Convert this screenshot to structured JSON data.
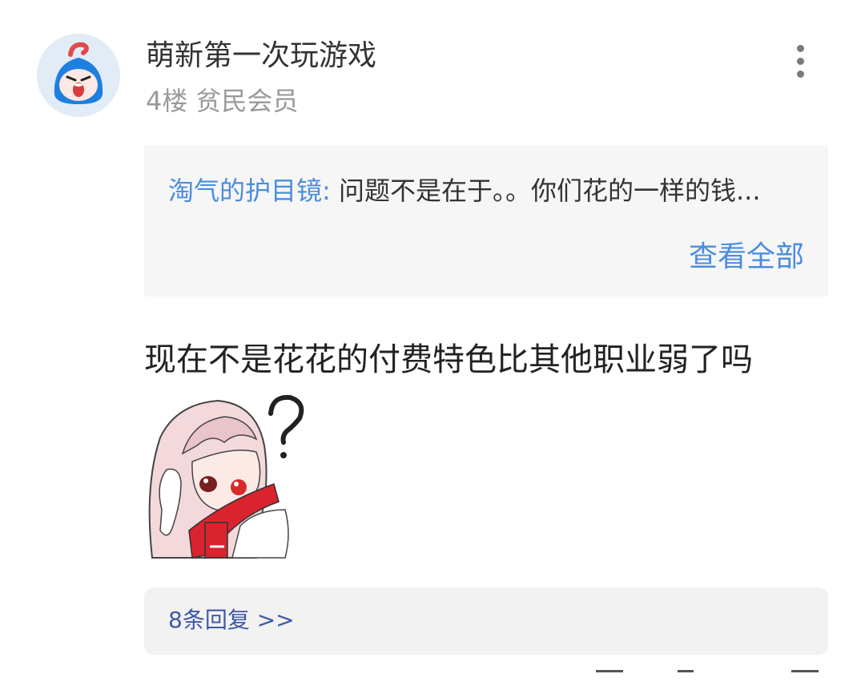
{
  "post": {
    "username": "萌新第一次玩游戏",
    "floor": "4楼",
    "member_level": "贫民会员",
    "avatar_icon": "angry-face-avatar-icon",
    "more_icon": "more-vertical-icon",
    "quote": {
      "author": "淘气的护目镜:",
      "text": "问题不是在于。。你们花的一样的钱...",
      "view_all_label": "查看全部"
    },
    "content_text": "现在不是花花的付费特色比其他职业弱了吗",
    "sticker_icon": "confused-anime-girl-sticker",
    "replies_label": "8条回复 >>"
  },
  "colors": {
    "link_blue": "#4a8de0",
    "reply_blue": "#3f59a8",
    "quote_bg": "#f6f6f6",
    "reply_bg": "#f2f2f2"
  }
}
